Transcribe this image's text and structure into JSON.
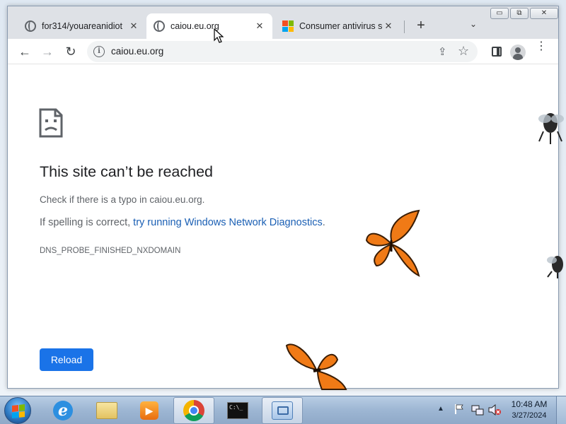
{
  "tabs": [
    {
      "title": "for314/youareanidiot",
      "icon": "globe-icon",
      "close": "✕"
    },
    {
      "title": "caiou.eu.org",
      "icon": "globe-icon",
      "close": "✕",
      "active": true
    },
    {
      "title": "Consumer antivirus so",
      "icon": "microsoft-logo-icon",
      "close": "✕"
    }
  ],
  "tabbar": {
    "new_tab": "+",
    "tab_search": "⌄"
  },
  "window_controls": {
    "minimize": "▭",
    "restore": "⧉",
    "close": "✕"
  },
  "toolbar": {
    "back": "←",
    "forward": "→",
    "reload": "↻",
    "url": "caiou.eu.org",
    "info": "i",
    "share": "⇪",
    "bookmark": "☆",
    "menu": "⋮"
  },
  "error_page": {
    "title": "This site can’t be reached",
    "line1": "Check if there is a typo in caiou.eu.org.",
    "line2_prefix": "If spelling is correct, ",
    "line2_link": "try running Windows Network Diagnostics",
    "line2_suffix": ".",
    "code": "DNS_PROBE_FINISHED_NXDOMAIN",
    "reload_label": "Reload"
  },
  "taskbar": {
    "items": [
      "internet-explorer-icon",
      "windows-explorer-icon",
      "windows-media-player-icon",
      "google-chrome-icon",
      "command-prompt-icon",
      "control-panel-icon"
    ],
    "cmd_glyph": "C:\\_",
    "wmp_glyph": "▶",
    "ie_glyph": "e",
    "tray_chevron": "▲",
    "clock_time": "10:48 AM",
    "clock_date": "3/27/2024"
  },
  "colors": {
    "accent": "#1a73e8",
    "link": "#1a5fb4",
    "butterfly": "#f07a16"
  }
}
